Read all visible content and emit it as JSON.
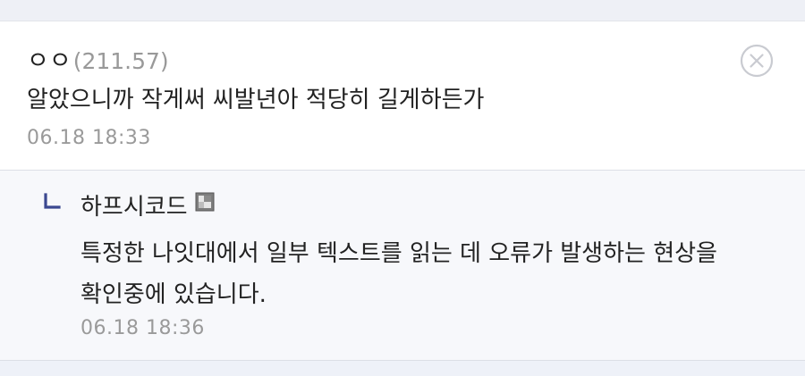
{
  "comment": {
    "nickname": "ㅇㅇ",
    "ip": "(211.57)",
    "text": "알았으니까 작게써 씨발년아 적당히 길게하든가",
    "date": "06.18 18:33",
    "delete_icon": "close-circle-icon"
  },
  "reply": {
    "nickname": "하프시코드",
    "badge_icon": "fixed-nick-icon",
    "text": "특정한 나잇대에서 일부 텍스트를 읽는 데 오류가 발생하는 현상을 확인중에 있습니다.",
    "date": "06.18 18:36",
    "arrow_icon": "reply-arrow-icon"
  },
  "colors": {
    "reply_background": "#f7f8fb",
    "reply_arrow": "#3b4890",
    "meta_gray": "#9a9a9a"
  }
}
